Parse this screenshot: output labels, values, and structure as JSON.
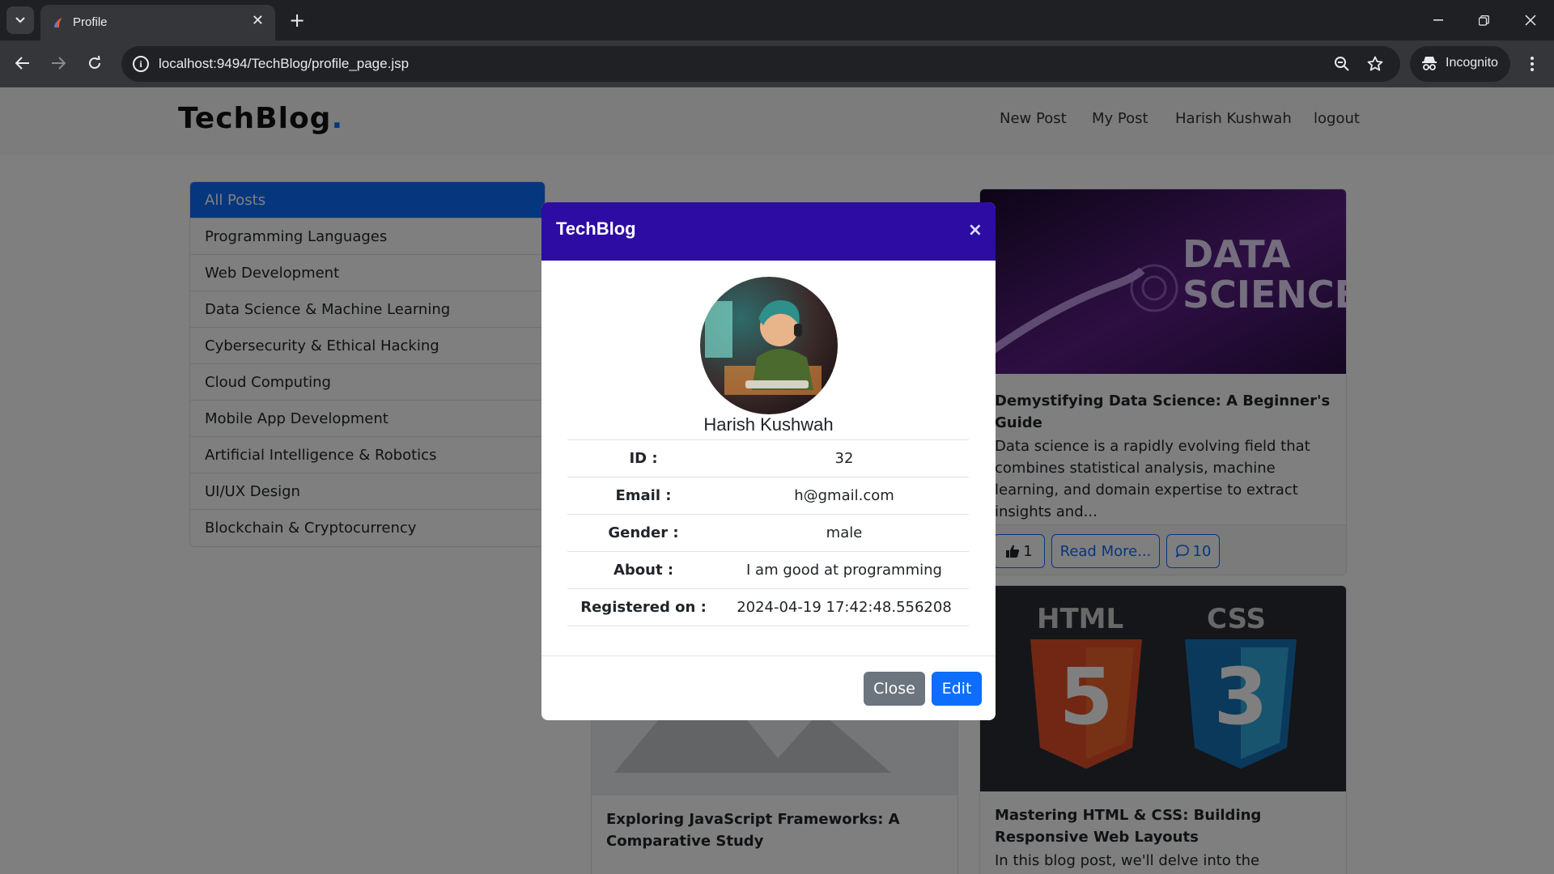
{
  "browser": {
    "tab_title": "Profile",
    "url": "localhost:9494/TechBlog/profile_page.jsp",
    "incognito_label": "Incognito"
  },
  "navbar": {
    "brand": "TechBlog",
    "brand_dot": ".",
    "links": [
      "New Post",
      "My Post",
      "Harish Kushwah",
      "logout"
    ]
  },
  "categories": [
    "All Posts",
    "Programming Languages",
    "Web Development",
    "Data Science & Machine Learning",
    "Cybersecurity & Ethical Hacking",
    "Cloud Computing",
    "Mobile App Development",
    "Artificial Intelligence & Robotics",
    "UI/UX Design",
    "Blockchain & Cryptocurrency"
  ],
  "posts": [
    {
      "image_text_1": "DATA",
      "image_text_2": "SCIENCE",
      "title": "Demystifying Data Science: A Beginner's Guide",
      "text": "Data science is a rapidly evolving field that combines statistical analysis, machine learning, and domain expertise to extract insights and...",
      "likes": "1",
      "read_more": "Read More...",
      "comments": "10"
    },
    {
      "title": "Exploring JavaScript Frameworks: A Comparative Study"
    },
    {
      "image_text_1": "HTML",
      "image_text_2": "CSS",
      "badge_1": "5",
      "badge_2": "3",
      "title": "Mastering HTML & CSS: Building Responsive Web Layouts",
      "text": "In this blog post, we'll delve into the"
    }
  ],
  "modal": {
    "title": "TechBlog",
    "close_symbol": "×",
    "name": "Harish Kushwah",
    "rows": [
      {
        "key": "ID :",
        "value": "32"
      },
      {
        "key": "Email :",
        "value": "h@gmail.com"
      },
      {
        "key": "Gender :",
        "value": "male"
      },
      {
        "key": "About :",
        "value": "I am good at programming"
      },
      {
        "key": "Registered on :",
        "value": "2024-04-19 17:42:48.556208"
      }
    ],
    "close_button": "Close",
    "edit_button": "Edit"
  },
  "colors": {
    "modal_header": "#2c0ca3",
    "primary": "#0d6efd",
    "secondary": "#6c757d"
  }
}
